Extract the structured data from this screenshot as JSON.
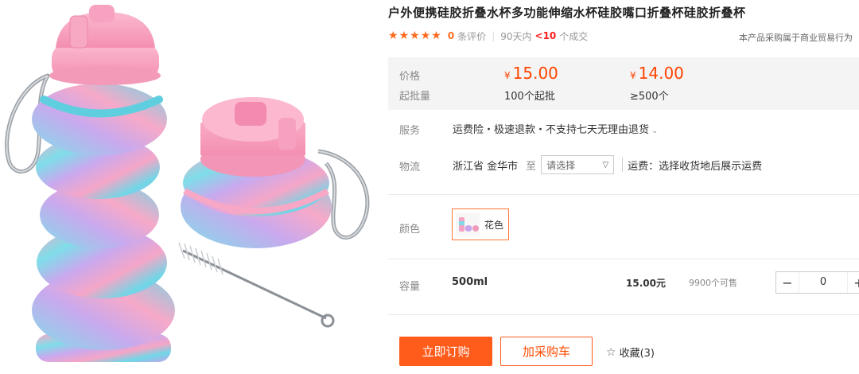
{
  "product": {
    "title": "户外便携硅胶折叠水杯多功能伸缩水杯硅胶嘴口折叠杯硅胶折叠杯"
  },
  "rating": {
    "stars": 5,
    "review_count": "0",
    "review_suffix": "条评价",
    "period": "90天内",
    "deal_count": "<10",
    "deal_suffix": "个成交",
    "trade_note": "本产品采购属于商业贸易行为"
  },
  "pricing": {
    "price_label": "价格",
    "moq_label": "起批量",
    "currency": "¥",
    "tiers": [
      {
        "price": "15.00",
        "qty": "100个起批"
      },
      {
        "price": "14.00",
        "qty": "≥500个"
      }
    ]
  },
  "service": {
    "label": "服务",
    "text": "运费险・极速退款・不支持七天无理由退货"
  },
  "logistics": {
    "label": "物流",
    "origin": "浙江省 金华市",
    "to": "至",
    "select_placeholder": "请选择",
    "shipping_note": "运费：选择收货地后展示运费"
  },
  "color": {
    "label": "颜色",
    "options": [
      {
        "name": "花色",
        "selected": true
      }
    ]
  },
  "capacity": {
    "label": "容量",
    "spec": "500ml",
    "price": "15.00元",
    "stock": "9900个可售",
    "quantity": "0",
    "minus": "−",
    "plus": "+"
  },
  "actions": {
    "buy_now": "立即订购",
    "add_cart": "加采购车",
    "favorite": "收藏(3)"
  },
  "colors": {
    "accent": "#ff5b1b",
    "price": "#ff4400",
    "deal": "#ff1e1e"
  }
}
